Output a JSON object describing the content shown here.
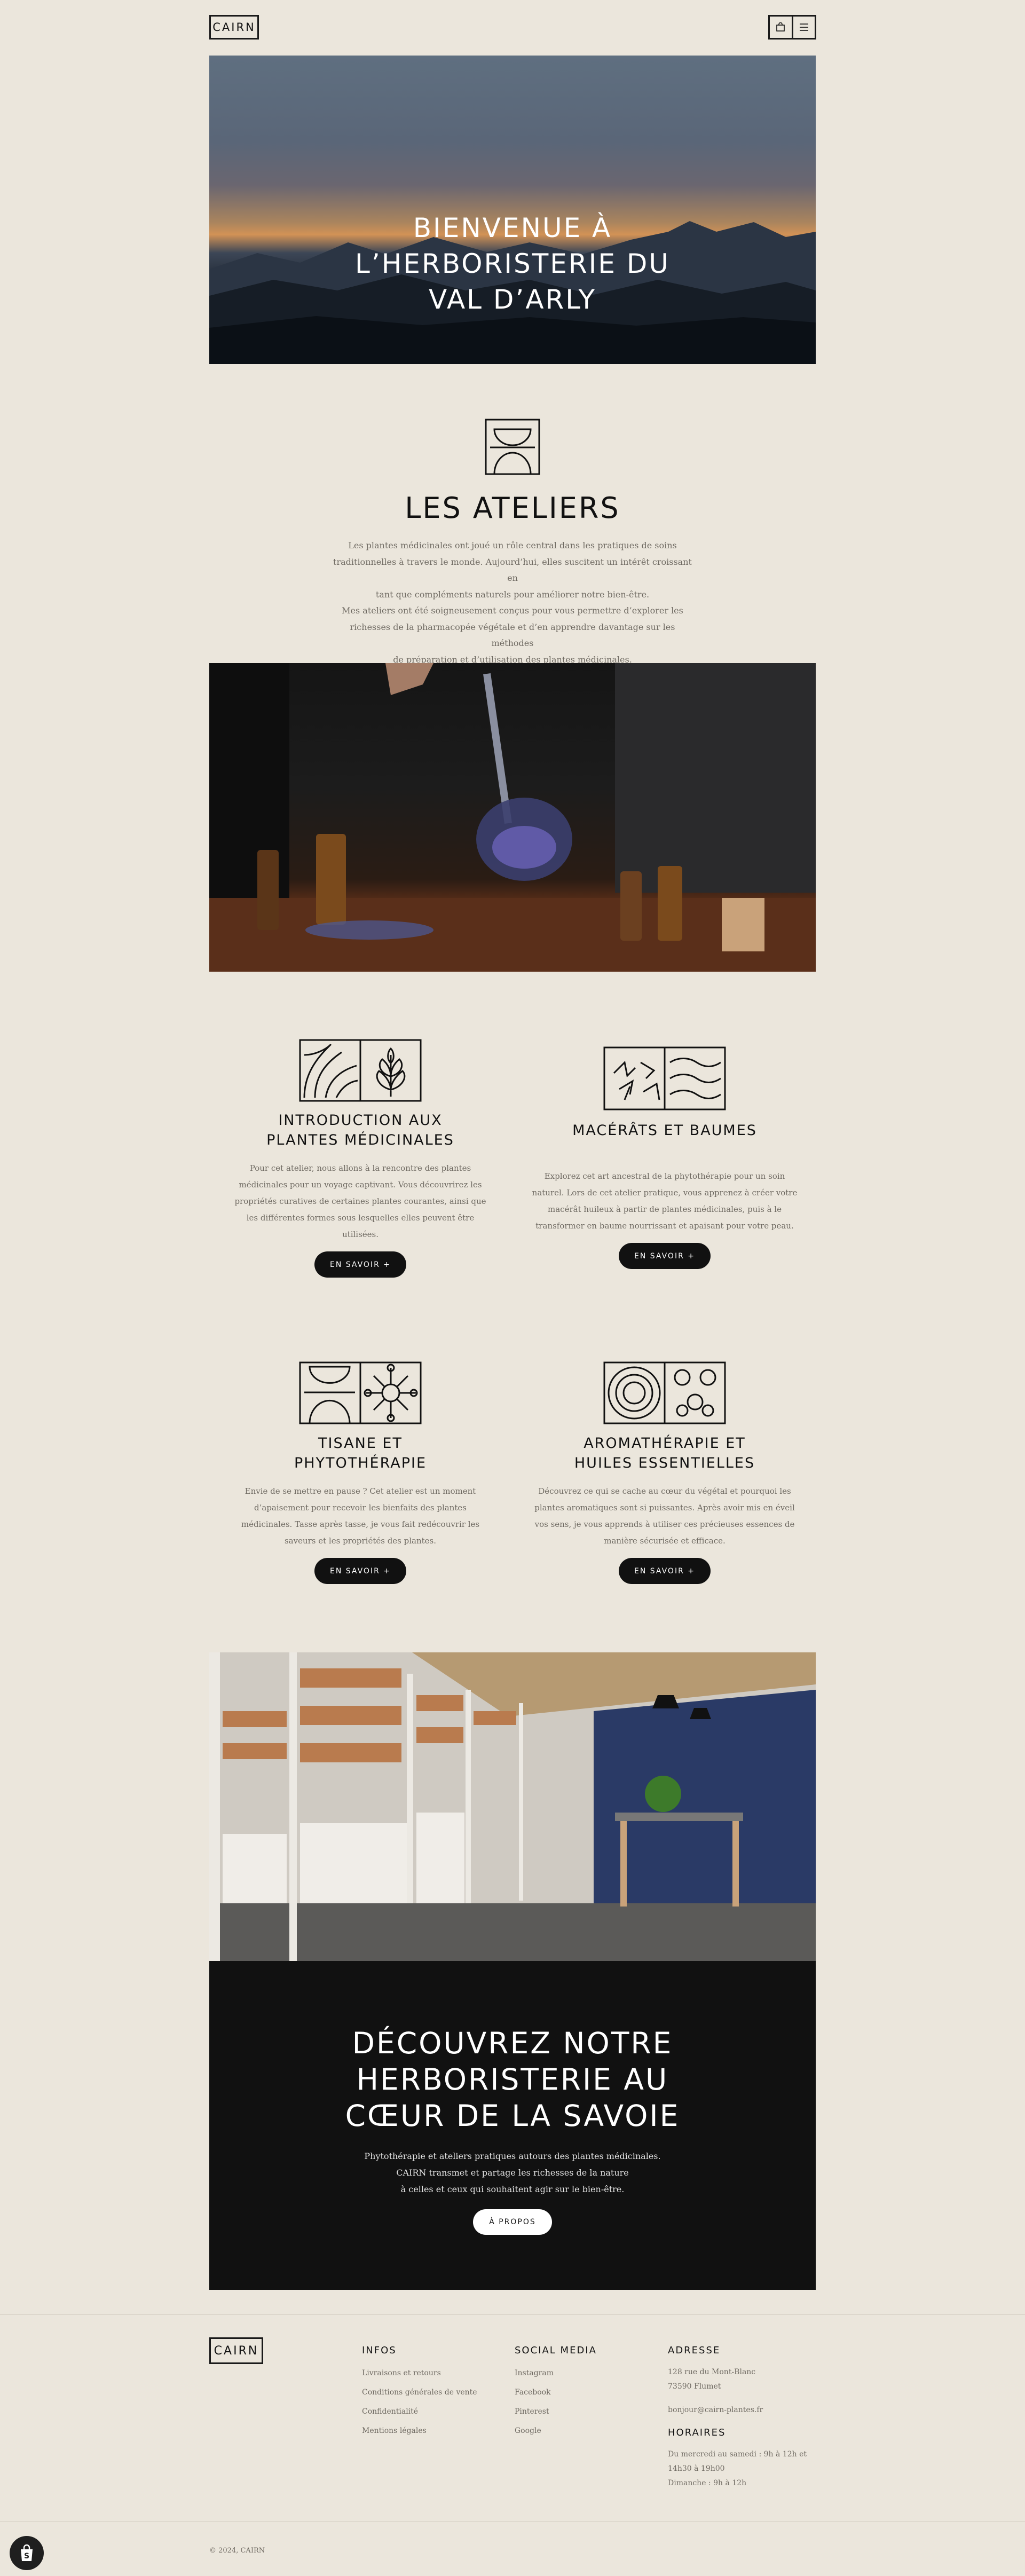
{
  "header": {
    "logo": "CAIRN",
    "cart_icon": "bag-icon",
    "menu_icon": "menu-icon"
  },
  "hero": {
    "title_line1": "BIENVENUE À",
    "title_line2": "L’HERBORISTERIE DU",
    "title_line3": "VAL D’ARLY"
  },
  "ateliers": {
    "title": "LES ATELIERS",
    "intro_lines": [
      "Les plantes médicinales ont joué un rôle central dans les pratiques de soins",
      "traditionnelles à travers le monde. Aujourd’hui, elles suscitent un intérêt croissant en",
      "tant que compléments naturels pour améliorer notre bien-être.",
      "Mes ateliers ont été soigneusement conçus pour vous permettre d’explorer les",
      "richesses de la pharmacopée végétale et d’en apprendre davantage sur les méthodes",
      "de préparation et d’utilisation des plantes médicinales."
    ]
  },
  "workshops": [
    {
      "title_lines": [
        "INTRODUCTION AUX",
        "PLANTES MÉDICINALES"
      ],
      "text_lines": [
        "Pour cet atelier, nous allons à la rencontre des plantes",
        "médicinales pour un voyage captivant. Vous découvrirez les",
        "propriétés curatives de certaines plantes courantes, ainsi que",
        "les différentes formes sous lesquelles elles peuvent être",
        "utilisées."
      ],
      "button": "EN SAVOIR +"
    },
    {
      "title_lines": [
        "MACÉRÂTS ET BAUMES"
      ],
      "text_lines": [
        "Explorez cet art ancestral de la phytothérapie pour un soin",
        "naturel. Lors de cet atelier pratique, vous apprenez à créer votre",
        "macérât huileux à partir de plantes médicinales, puis à le",
        "transformer en baume nourrissant et apaisant pour votre peau."
      ],
      "button": "EN SAVOIR +"
    },
    {
      "title_lines": [
        "TISANE ET",
        "PHYTOTHÉRAPIE"
      ],
      "text_lines": [
        "Envie de se mettre en pause ? Cet atelier est un moment",
        "d’apaisement pour recevoir les bienfaits des plantes",
        "médicinales. Tasse après tasse, je vous fait redécouvrir les",
        "saveurs et les propriétés des plantes."
      ],
      "button": "EN SAVOIR +"
    },
    {
      "title_lines": [
        "AROMATHÉRAPIE ET",
        "HUILES ESSENTIELLES"
      ],
      "text_lines": [
        "Découvrez ce qui se cache au cœur du végétal et pourquoi les",
        "plantes aromatiques sont si puissantes. Après avoir mis en éveil",
        "vos sens, je vous apprends à utiliser ces précieuses essences de",
        "manière sécurisée et efficace."
      ],
      "button": "EN SAVOIR +"
    }
  ],
  "discover": {
    "title_lines": [
      "DÉCOUVREZ NOTRE",
      "HERBORISTERIE AU",
      "CŒUR DE LA SAVOIE"
    ],
    "text_lines": [
      "Phytothérapie et ateliers pratiques autours des plantes médicinales.",
      "CAIRN transmet et partage les richesses de la nature",
      "à celles et ceux qui souhaitent agir sur le bien-être."
    ],
    "button": "À PROPOS"
  },
  "footer": {
    "logo": "CAIRN",
    "infos": {
      "heading": "INFOS",
      "links": [
        "Livraisons et retours",
        "Conditions générales de vente",
        "Confidentialité",
        "Mentions légales"
      ]
    },
    "social": {
      "heading": "SOCIAL MEDIA",
      "links": [
        "Instagram",
        "Facebook",
        "Pinterest",
        "Google"
      ]
    },
    "address": {
      "heading": "ADRESSE",
      "lines": [
        "128 rue du Mont-Blanc",
        "73590 Flumet"
      ],
      "email": "bonjour@cairn-plantes.fr"
    },
    "hours": {
      "heading": "HORAIRES",
      "lines": [
        "Du mercredi au samedi : 9h à 12h et",
        "14h30 à 19h00",
        "Dimanche : 9h à 12h"
      ]
    },
    "copyright": "© 2024, CAIRN"
  },
  "colors": {
    "background": "#ebe6dc",
    "ink": "#111111",
    "muted_text": "#6f6a62"
  }
}
